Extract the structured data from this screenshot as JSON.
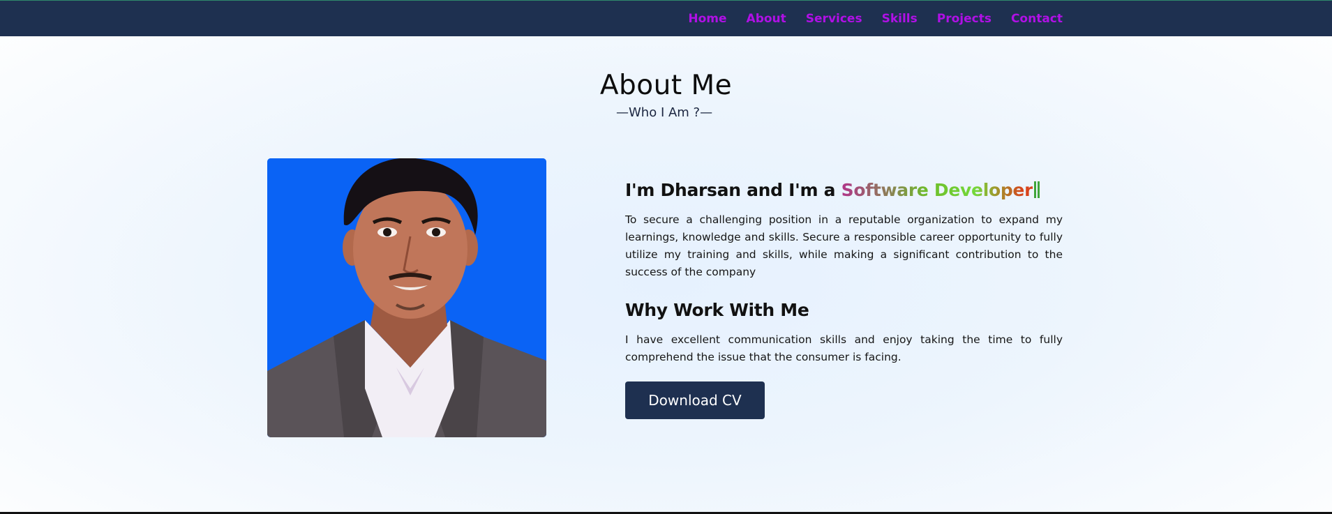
{
  "nav": {
    "links": [
      "Home",
      "About",
      "Services",
      "Skills",
      "Projects",
      "Contact"
    ]
  },
  "about": {
    "title": "About Me",
    "subtitle": "—Who I Am ?—",
    "intro_prefix": "I'm Dharsan and I'm a ",
    "typed_role": "Software Developer",
    "objective": "To secure a challenging position in a reputable organization to expand my learnings, knowledge and skills. Secure a responsible career opportunity to fully utilize my training and skills, while making a significant contribution to the success of the company",
    "why_heading": "Why Work With Me",
    "why_text": "I have excellent communication skills and enjoy taking the time to fully comprehend the issue that the consumer is facing.",
    "download_label": "Download CV"
  },
  "colors": {
    "nav_background": "#1e3050",
    "nav_link": "#b010e6",
    "button_background": "#1e3050",
    "photo_background": "#0a63f5"
  },
  "icons": {
    "profile": "profile-photo"
  }
}
